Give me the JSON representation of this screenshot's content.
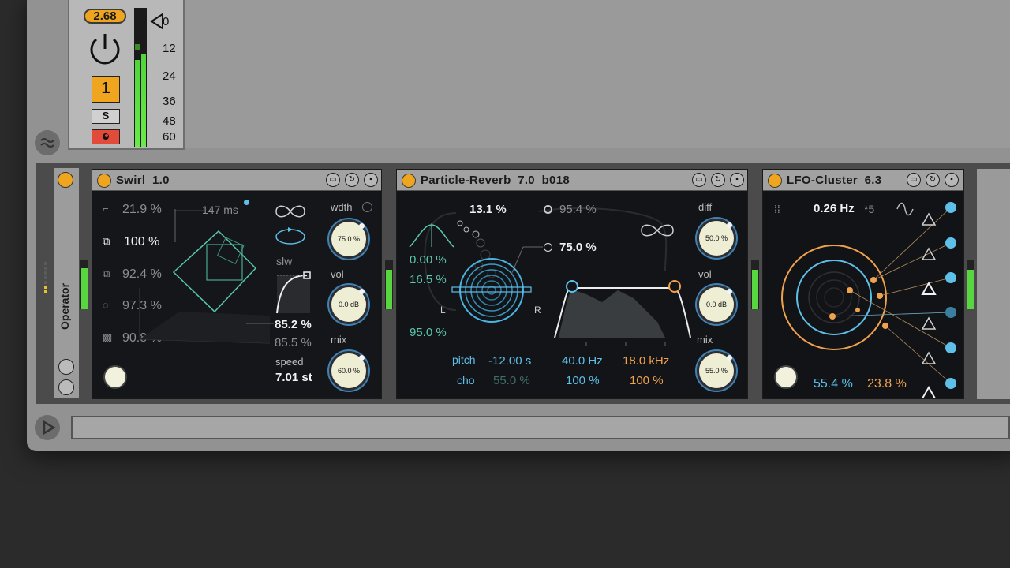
{
  "mixer": {
    "tempo": "2.68",
    "track_number": "1",
    "solo_label": "S",
    "db_scale": [
      "0",
      "12",
      "24",
      "36",
      "48",
      "60"
    ]
  },
  "chain": {
    "device_label": "Operator"
  },
  "swirl": {
    "title": "Swirl_1.0",
    "params": [
      "21.9 %",
      "100 %",
      "92.4 %",
      "97.3 %",
      "90.8 %"
    ],
    "time": "147 ms",
    "slw_label": "slw",
    "value1": "85.2 %",
    "value2": "85.5 %",
    "speed_label": "speed",
    "speed_value": "7.01 st",
    "wdth_label": "wdth",
    "wdth_value": "75.0 %",
    "vol_label": "vol",
    "vol_value": "0.0 dB",
    "mix_label": "mix",
    "mix_value": "60.0 %"
  },
  "reverb": {
    "title": "Particle-Reverb_7.0_b018",
    "p1": "13.1 %",
    "p2": "95.4 %",
    "p3": "75.0 %",
    "teal1": "0.00 %",
    "teal2": "16.5 %",
    "teal3": "95.0 %",
    "l_label": "L",
    "r_label": "R",
    "pitch_label": "pitch",
    "pitch_value": "-12.00 s",
    "cho_label": "cho",
    "cho_value": "55.0 %",
    "low_freq": "40.0 Hz",
    "low_pct": "100 %",
    "high_freq": "18.0 kHz",
    "high_pct": "100 %",
    "diff_label": "diff",
    "diff_value": "50.0 %",
    "vol_label": "vol",
    "vol_value": "0.0 dB",
    "mix_label": "mix",
    "mix_value": "55.0 %"
  },
  "lfo": {
    "title": "LFO-Cluster_6.3",
    "rate": "0.26 Hz",
    "mult": "*5",
    "val_blue": "55.4 %",
    "val_orange": "23.8 %"
  },
  "colors": {
    "accent": "#f0a51e",
    "teal": "#5bc7ad",
    "blue": "#5ebfe8",
    "orange": "#f0a24c",
    "meter_green": "#6bea4a"
  }
}
